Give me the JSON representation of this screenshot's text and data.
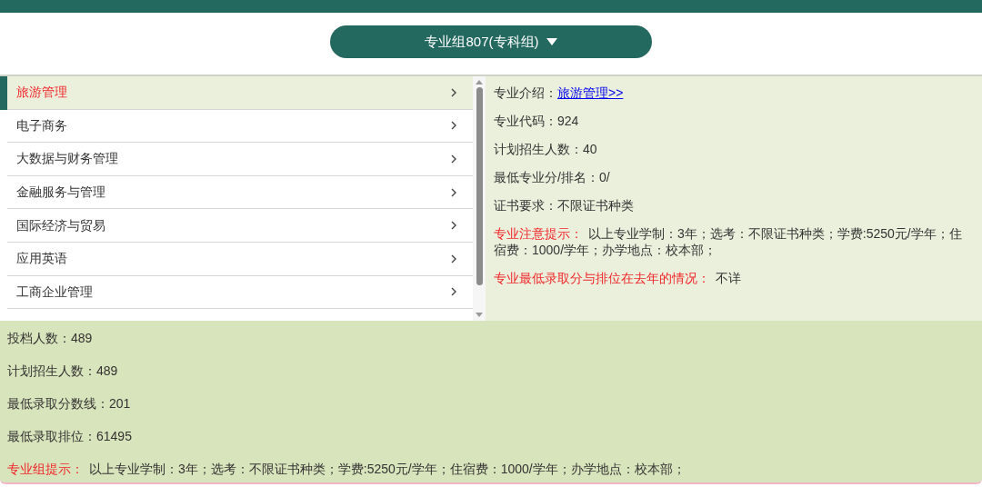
{
  "group_selector": {
    "label": "专业组807(专科组)"
  },
  "majors": [
    {
      "name": "旅游管理",
      "selected": true
    },
    {
      "name": "电子商务",
      "selected": false
    },
    {
      "name": "大数据与财务管理",
      "selected": false
    },
    {
      "name": "金融服务与管理",
      "selected": false
    },
    {
      "name": "国际经济与贸易",
      "selected": false
    },
    {
      "name": "应用英语",
      "selected": false
    },
    {
      "name": "工商企业管理",
      "selected": false
    }
  ],
  "major_details": [
    {
      "kind": "link",
      "label": "专业介绍：",
      "value": "旅游管理>>"
    },
    {
      "kind": "plain",
      "label": "专业代码：",
      "value": "924"
    },
    {
      "kind": "plain",
      "label": "计划招生人数：",
      "value": "40"
    },
    {
      "kind": "plain",
      "label": "最低专业分/排名：",
      "value": "0/"
    },
    {
      "kind": "plain",
      "label": "证书要求：",
      "value": "不限证书种类"
    },
    {
      "kind": "alert",
      "label": "专业注意提示：",
      "value": "以上专业学制：3年；选考：不限证书种类；学费:5250元/学年；住宿费：1000/学年；办学地点：校本部；"
    },
    {
      "kind": "alert",
      "label": "专业最低录取分与排位在去年的情况：",
      "value": "不详"
    }
  ],
  "group_details": [
    {
      "kind": "plain",
      "label": "投档人数：",
      "value": "489"
    },
    {
      "kind": "plain",
      "label": "计划招生人数：",
      "value": "489"
    },
    {
      "kind": "plain",
      "label": "最低录取分数线：",
      "value": "201"
    },
    {
      "kind": "plain",
      "label": "最低录取排位：",
      "value": "61495"
    },
    {
      "kind": "alert",
      "label": "专业组提示：",
      "value": "以上专业学制：3年；选考：不限证书种类；学费:5250元/学年；住宿费：1000/学年；办学地点：校本部；"
    }
  ]
}
